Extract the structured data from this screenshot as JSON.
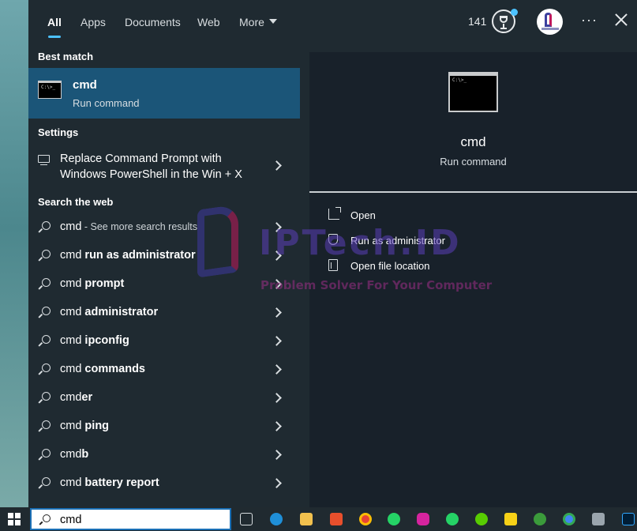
{
  "header": {
    "tabs": [
      {
        "label": "All"
      },
      {
        "label": "Apps"
      },
      {
        "label": "Documents"
      },
      {
        "label": "Web"
      },
      {
        "label": "More"
      }
    ],
    "points": "141"
  },
  "best_match": {
    "section_label": "Best match",
    "title": "cmd",
    "subtitle": "Run command"
  },
  "settings": {
    "section_label": "Settings",
    "item_label": "Replace Command Prompt with Windows PowerShell in the Win + X"
  },
  "web": {
    "section_label": "Search the web",
    "items": [
      {
        "query": "cmd",
        "suffix": "",
        "hint": " - See more search results"
      },
      {
        "query": "cmd",
        "suffix": " run as administrator",
        "hint": ""
      },
      {
        "query": "cmd",
        "suffix": " prompt",
        "hint": ""
      },
      {
        "query": "cmd",
        "suffix": " administrator",
        "hint": ""
      },
      {
        "query": "cmd",
        "suffix": " ipconfig",
        "hint": ""
      },
      {
        "query": "cmd",
        "suffix": " commands",
        "hint": ""
      },
      {
        "query": "cmd",
        "suffix": "er",
        "hint": ""
      },
      {
        "query": "cmd",
        "suffix": " ping",
        "hint": ""
      },
      {
        "query": "cmd",
        "suffix": "b",
        "hint": ""
      },
      {
        "query": "cmd",
        "suffix": " battery report",
        "hint": ""
      }
    ]
  },
  "preview": {
    "title": "cmd",
    "subtitle": "Run command",
    "actions": [
      {
        "label": "Open",
        "icon": "open-icon"
      },
      {
        "label": "Run as administrator",
        "icon": "shield-icon"
      },
      {
        "label": "Open file location",
        "icon": "folder-icon"
      }
    ]
  },
  "watermark": {
    "brand": "IPTech.ID",
    "tagline": "Problem Solver For Your Computer"
  },
  "search": {
    "value": "cmd"
  },
  "colors": {
    "accent": "#4cc2ff",
    "selection": "#1b5578",
    "panel": "#1f2a31",
    "preview_panel": "#18212a"
  }
}
